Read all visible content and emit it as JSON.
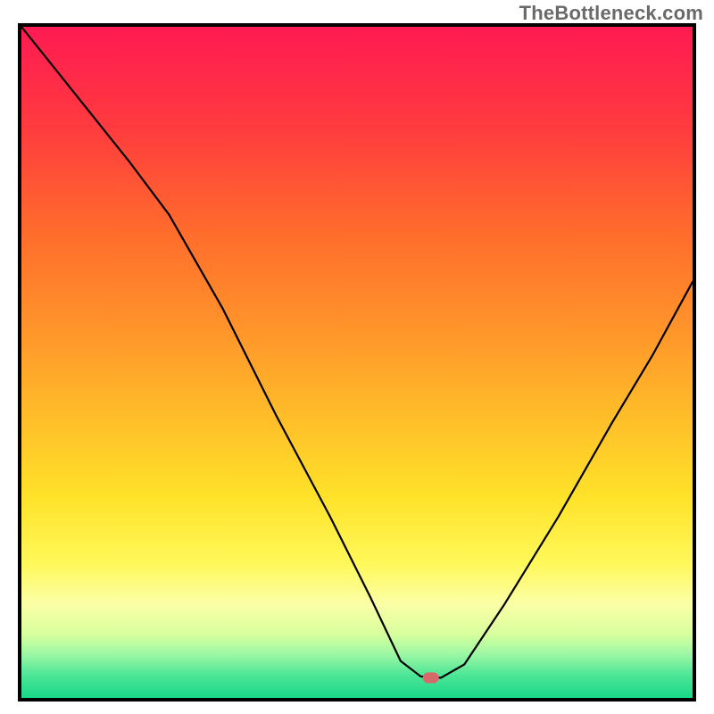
{
  "watermark": "TheBottleneck.com",
  "chart_data": {
    "type": "line",
    "title": "",
    "xlabel": "",
    "ylabel": "",
    "xlim": [
      0,
      100
    ],
    "ylim": [
      0,
      100
    ],
    "x": [
      0,
      8,
      16,
      22,
      30,
      38,
      46,
      52,
      56.5,
      59.5,
      62.5,
      66,
      72,
      80,
      88,
      94,
      100
    ],
    "values": [
      100,
      90,
      80,
      72,
      58,
      42,
      27,
      15,
      5.5,
      3.2,
      3.0,
      5,
      14,
      27,
      41,
      51,
      62
    ],
    "marker": {
      "x": 61.0,
      "y": 3.0,
      "w": 2.4,
      "h": 1.6
    },
    "gradient_stops": [
      {
        "offset": 0.0,
        "color": "#ff1a52"
      },
      {
        "offset": 0.15,
        "color": "#ff3b3f"
      },
      {
        "offset": 0.3,
        "color": "#ff6a2c"
      },
      {
        "offset": 0.45,
        "color": "#ff942a"
      },
      {
        "offset": 0.58,
        "color": "#ffbd29"
      },
      {
        "offset": 0.7,
        "color": "#ffe229"
      },
      {
        "offset": 0.8,
        "color": "#fff85a"
      },
      {
        "offset": 0.86,
        "color": "#fbffa6"
      },
      {
        "offset": 0.905,
        "color": "#d8ff9e"
      },
      {
        "offset": 0.935,
        "color": "#9cf7a4"
      },
      {
        "offset": 0.965,
        "color": "#4fe697"
      },
      {
        "offset": 1.0,
        "color": "#18d989"
      }
    ]
  }
}
